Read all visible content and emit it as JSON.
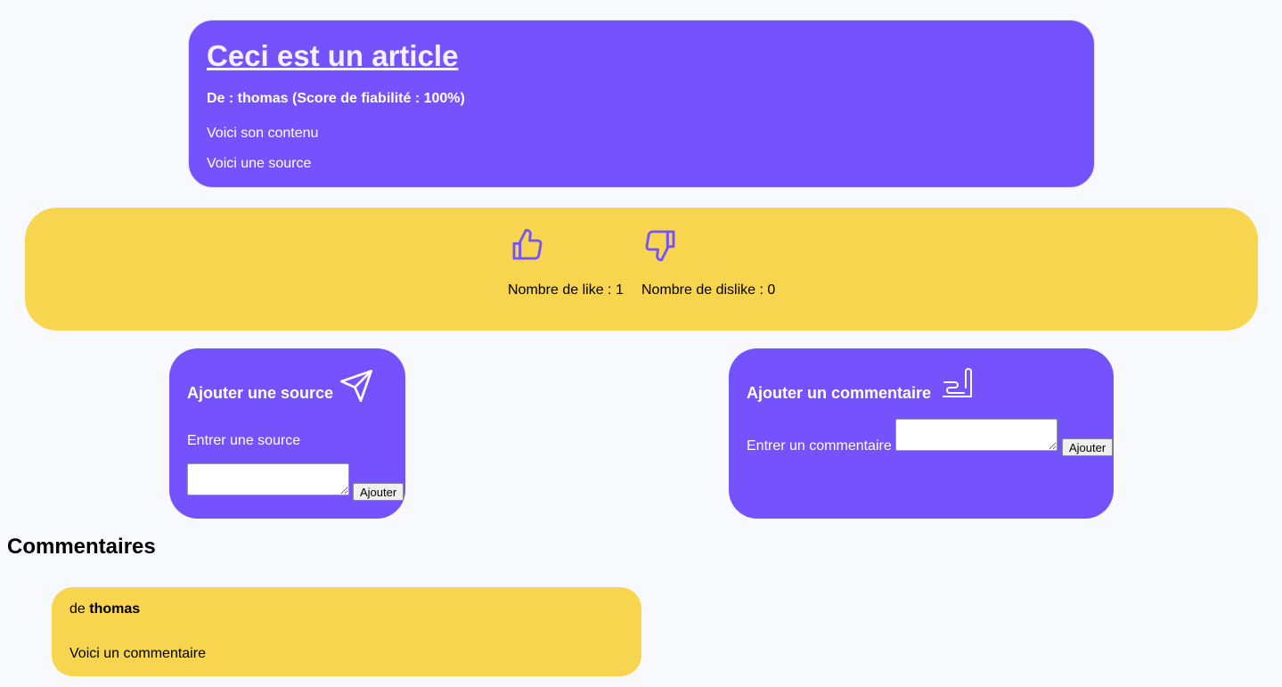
{
  "article": {
    "title": "Ceci est un article",
    "author_line": "De : thomas (Score de fiabilité : 100%)",
    "content": "Voici son contenu",
    "source": "Voici une source"
  },
  "votes": {
    "like_label": "Nombre de like : 1",
    "dislike_label": "Nombre de dislike : 0",
    "like_icon": "thumbs-up-icon",
    "dislike_icon": "thumbs-down-icon"
  },
  "add_source": {
    "title": "Ajouter une source",
    "icon": "send-icon",
    "label": "Entrer une source",
    "value": "",
    "button_label": "Ajouter"
  },
  "add_comment": {
    "title": "Ajouter un commentaire",
    "icon": "pencil-icon",
    "label": "Entrer un commentaire",
    "value": "",
    "button_label": "Ajouter"
  },
  "comments": {
    "heading": "Commentaires",
    "items": [
      {
        "prefix": "de",
        "author": "thomas",
        "text": "Voici un commentaire"
      }
    ]
  },
  "colors": {
    "primary": "#7452fe",
    "accent": "#f8d54e",
    "background": "#f8f9fd"
  }
}
